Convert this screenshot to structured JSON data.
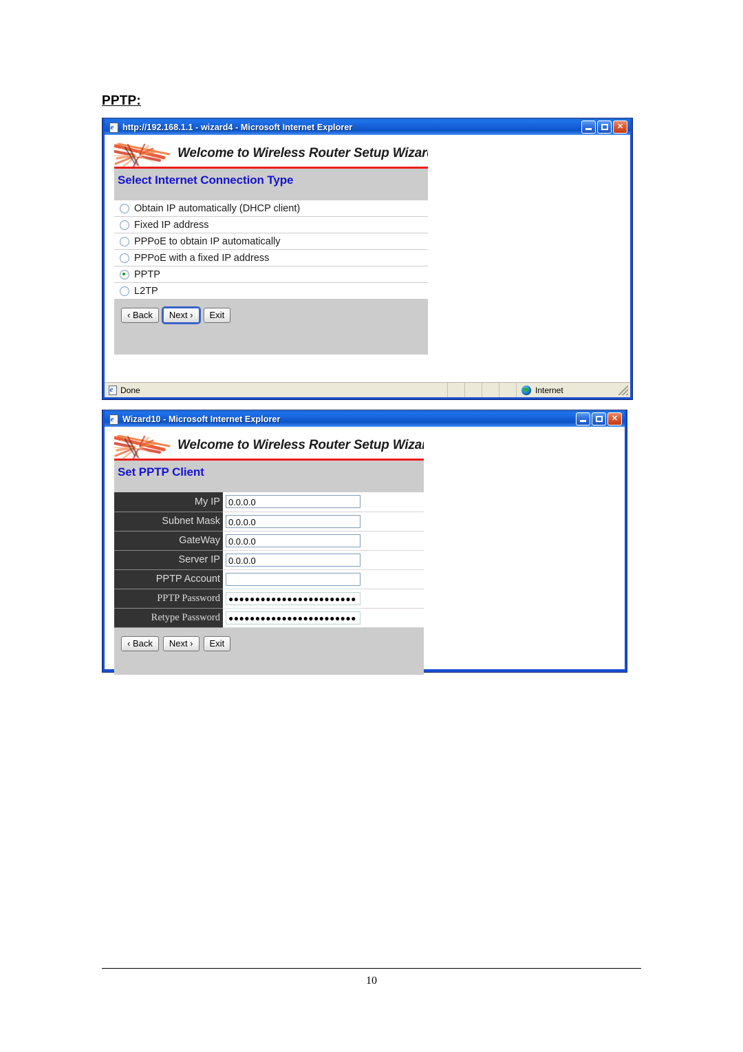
{
  "document": {
    "heading": "PPTP:",
    "page_number": "10"
  },
  "window1": {
    "title": "http://192.168.1.1 - wizard4 - Microsoft Internet Explorer",
    "icon": "ie-page-icon",
    "controls": {
      "minimize": "Minimize",
      "maximize": "Maximize",
      "close": "Close"
    },
    "banner": "Welcome to Wireless Router Setup Wizard",
    "section_title": "Select Internet Connection Type",
    "options": [
      {
        "label": "Obtain IP automatically (DHCP client)",
        "selected": false
      },
      {
        "label": "Fixed IP address",
        "selected": false
      },
      {
        "label": "PPPoE to obtain IP automatically",
        "selected": false
      },
      {
        "label": "PPPoE with a fixed IP address",
        "selected": false
      },
      {
        "label": "PPTP",
        "selected": true
      },
      {
        "label": "L2TP",
        "selected": false
      }
    ],
    "buttons": {
      "back": "‹ Back",
      "next": "Next ›",
      "exit": "Exit"
    },
    "statusbar": {
      "text": "Done",
      "zone": "Internet"
    }
  },
  "window2": {
    "title": "Wizard10 - Microsoft Internet Explorer",
    "icon": "ie-page-icon",
    "controls": {
      "minimize": "Minimize",
      "maximize": "Maximize",
      "close": "Close"
    },
    "banner": "Welcome to Wireless Router Setup Wizard",
    "section_title": "Set PPTP Client",
    "fields": [
      {
        "label": "My IP",
        "value": "0.0.0.0",
        "type": "text"
      },
      {
        "label": "Subnet Mask",
        "value": "0.0.0.0",
        "type": "text"
      },
      {
        "label": "GateWay",
        "value": "0.0.0.0",
        "type": "text"
      },
      {
        "label": "Server IP",
        "value": "0.0.0.0",
        "type": "text"
      },
      {
        "label": "PPTP Account",
        "value": "",
        "type": "text"
      },
      {
        "label": "PPTP Password",
        "value": "●●●●●●●●●●●●●●●●●●●●●●●●",
        "type": "password"
      },
      {
        "label": "Retype Password",
        "value": "●●●●●●●●●●●●●●●●●●●●●●●●",
        "type": "password"
      }
    ],
    "buttons": {
      "back": "‹ Back",
      "next": "Next ›",
      "exit": "Exit"
    }
  },
  "colors": {
    "titlebar_blue": "#1763dd",
    "window_border": "#1950d2",
    "panel_gray": "#cccccc",
    "section_heading_blue": "#1414cf",
    "banner_rule_red": "#ed1c16",
    "label_cell_dark": "#333333",
    "radio_selected_green": "#0f9f0f",
    "statusbar_beige": "#ece9d8"
  }
}
